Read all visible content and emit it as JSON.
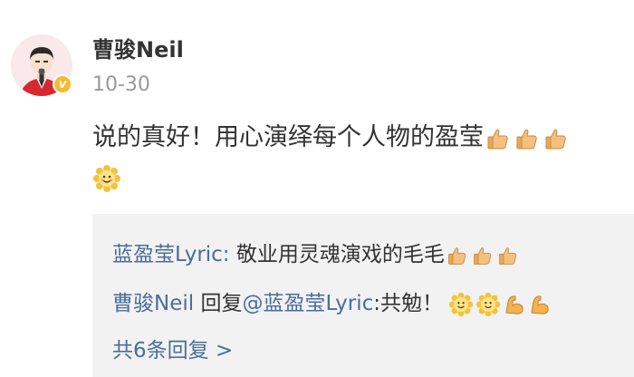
{
  "post": {
    "username": "曹骏Neil",
    "timestamp": "10-30",
    "verified_label": "v",
    "text": "说的真好！用心演绎每个人物的盈莹"
  },
  "replies": [
    {
      "author": "蓝盈莹Lyric:",
      "text": " 敬业用灵魂演戏的毛毛"
    },
    {
      "author": "曹骏Neil",
      "reply_word": " 回复",
      "mention": "@蓝盈莹Lyric",
      "text": ":共勉！"
    }
  ],
  "more_replies": "共6条回复 >",
  "icons": {
    "thumbs_up": "thumbs-up-icon",
    "smile": "smile-face-icon",
    "muscle": "flexed-biceps-icon",
    "verified": "verified-badge-icon"
  },
  "colors": {
    "link_blue": "#4a6d9e",
    "verified_gold": "#f6b935",
    "reply_bg": "#f2f2f2",
    "text": "#333333",
    "muted": "#999999"
  }
}
